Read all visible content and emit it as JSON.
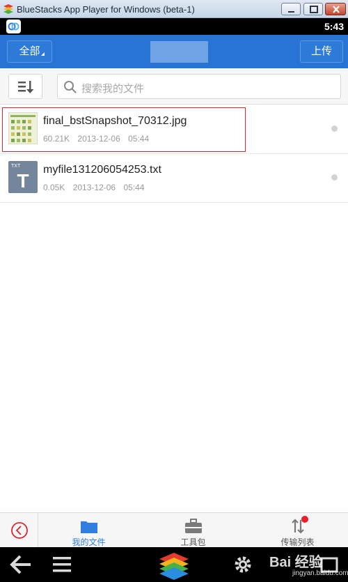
{
  "window": {
    "title": "BlueStacks App Player for Windows (beta-1)"
  },
  "status_bar": {
    "time": "5:43"
  },
  "header": {
    "left_button": "全部",
    "right_button": "上传"
  },
  "toolbar": {
    "search_placeholder": "搜索我的文件"
  },
  "files": [
    {
      "name": "final_bstSnapshot_70312.jpg",
      "size": "60.21K",
      "date": "2013-12-06",
      "time": "05:44",
      "icon": "image-thumbnail-icon"
    },
    {
      "name": "myfile131206054253.txt",
      "size": "0.05K",
      "date": "2013-12-06",
      "time": "05:44",
      "icon": "txt-file-icon",
      "icon_letter": "T",
      "icon_tag": "TXT"
    }
  ],
  "tabs": [
    {
      "label": "我的文件",
      "icon": "folder-icon",
      "active": true
    },
    {
      "label": "工具包",
      "icon": "toolbox-icon",
      "active": false
    },
    {
      "label": "传输列表",
      "icon": "transfer-icon",
      "active": false
    }
  ],
  "watermark": {
    "main": "Bai 经验",
    "sub": "jingyan.baidu.com"
  },
  "colors": {
    "header_blue": "#2774d5",
    "active_tab": "#2f7fe0",
    "highlight_border": "#d8272e",
    "notification_dot": "#e8202a"
  }
}
